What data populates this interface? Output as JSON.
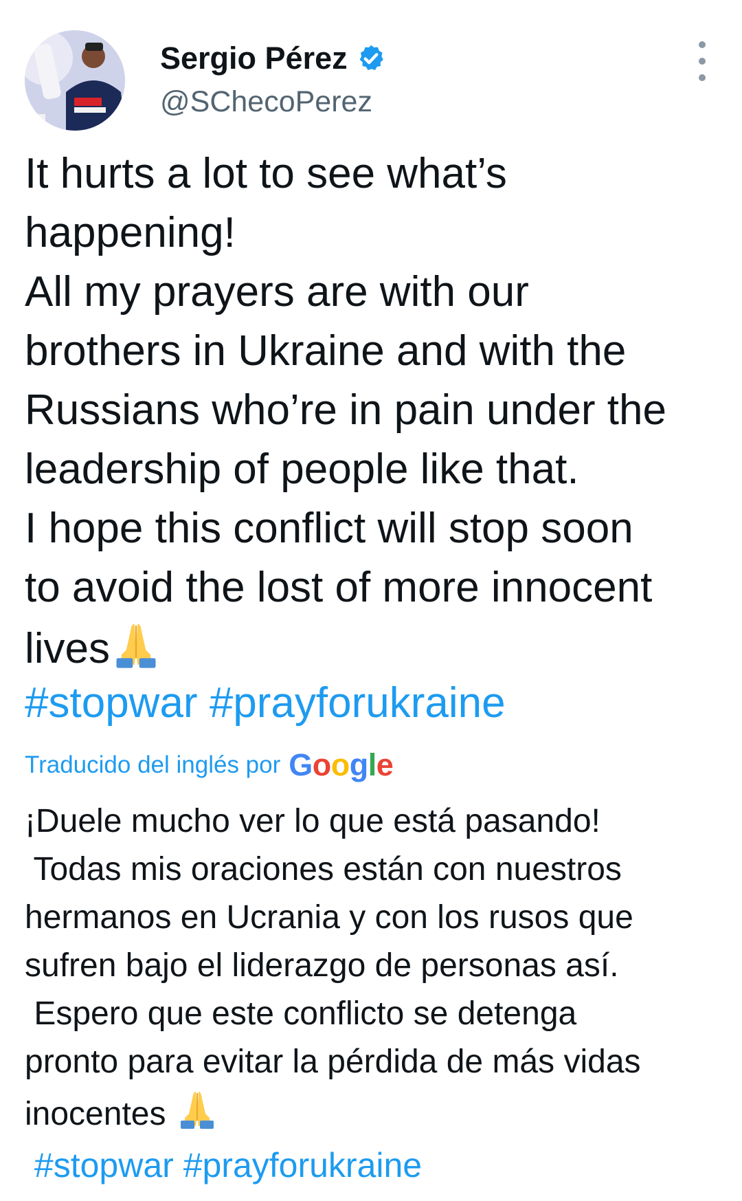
{
  "header": {
    "display_name": "Sergio Pérez",
    "handle": "@SChecoPerez",
    "verified_icon": "verified-badge-icon",
    "more_icon": "more-vertical-icon"
  },
  "tweet": {
    "lines_en": [
      "It hurts a lot to see what’s",
      "happening!",
      "All my prayers are with our",
      "brothers in Ukraine and with the",
      "Russians who’re in pain under the",
      "leadership of people like that.",
      "I hope this conflict will stop soon",
      "to avoid the lost of more innocent",
      "lives"
    ],
    "emoji": "folded-hands-emoji",
    "hashtags_en": [
      "#stopwar",
      "#prayforukraine"
    ],
    "translated_label": "Traducido del inglés por",
    "translator": "Google",
    "lines_es": [
      "¡Duele mucho ver lo que está pasando!",
      " Todas mis oraciones están con nuestros",
      "hermanos en Ucrania y con los rusos que",
      "sufren bajo el liderazgo de personas así.",
      " Espero que este conflicto se detenga",
      "pronto para evitar la pérdida de más vidas",
      "inocentes "
    ],
    "hashtags_es": [
      " #stopwar",
      "#prayforukraine"
    ]
  },
  "colors": {
    "link": "#1d9bf0",
    "text": "#0f1419",
    "secondary": "#536471"
  }
}
